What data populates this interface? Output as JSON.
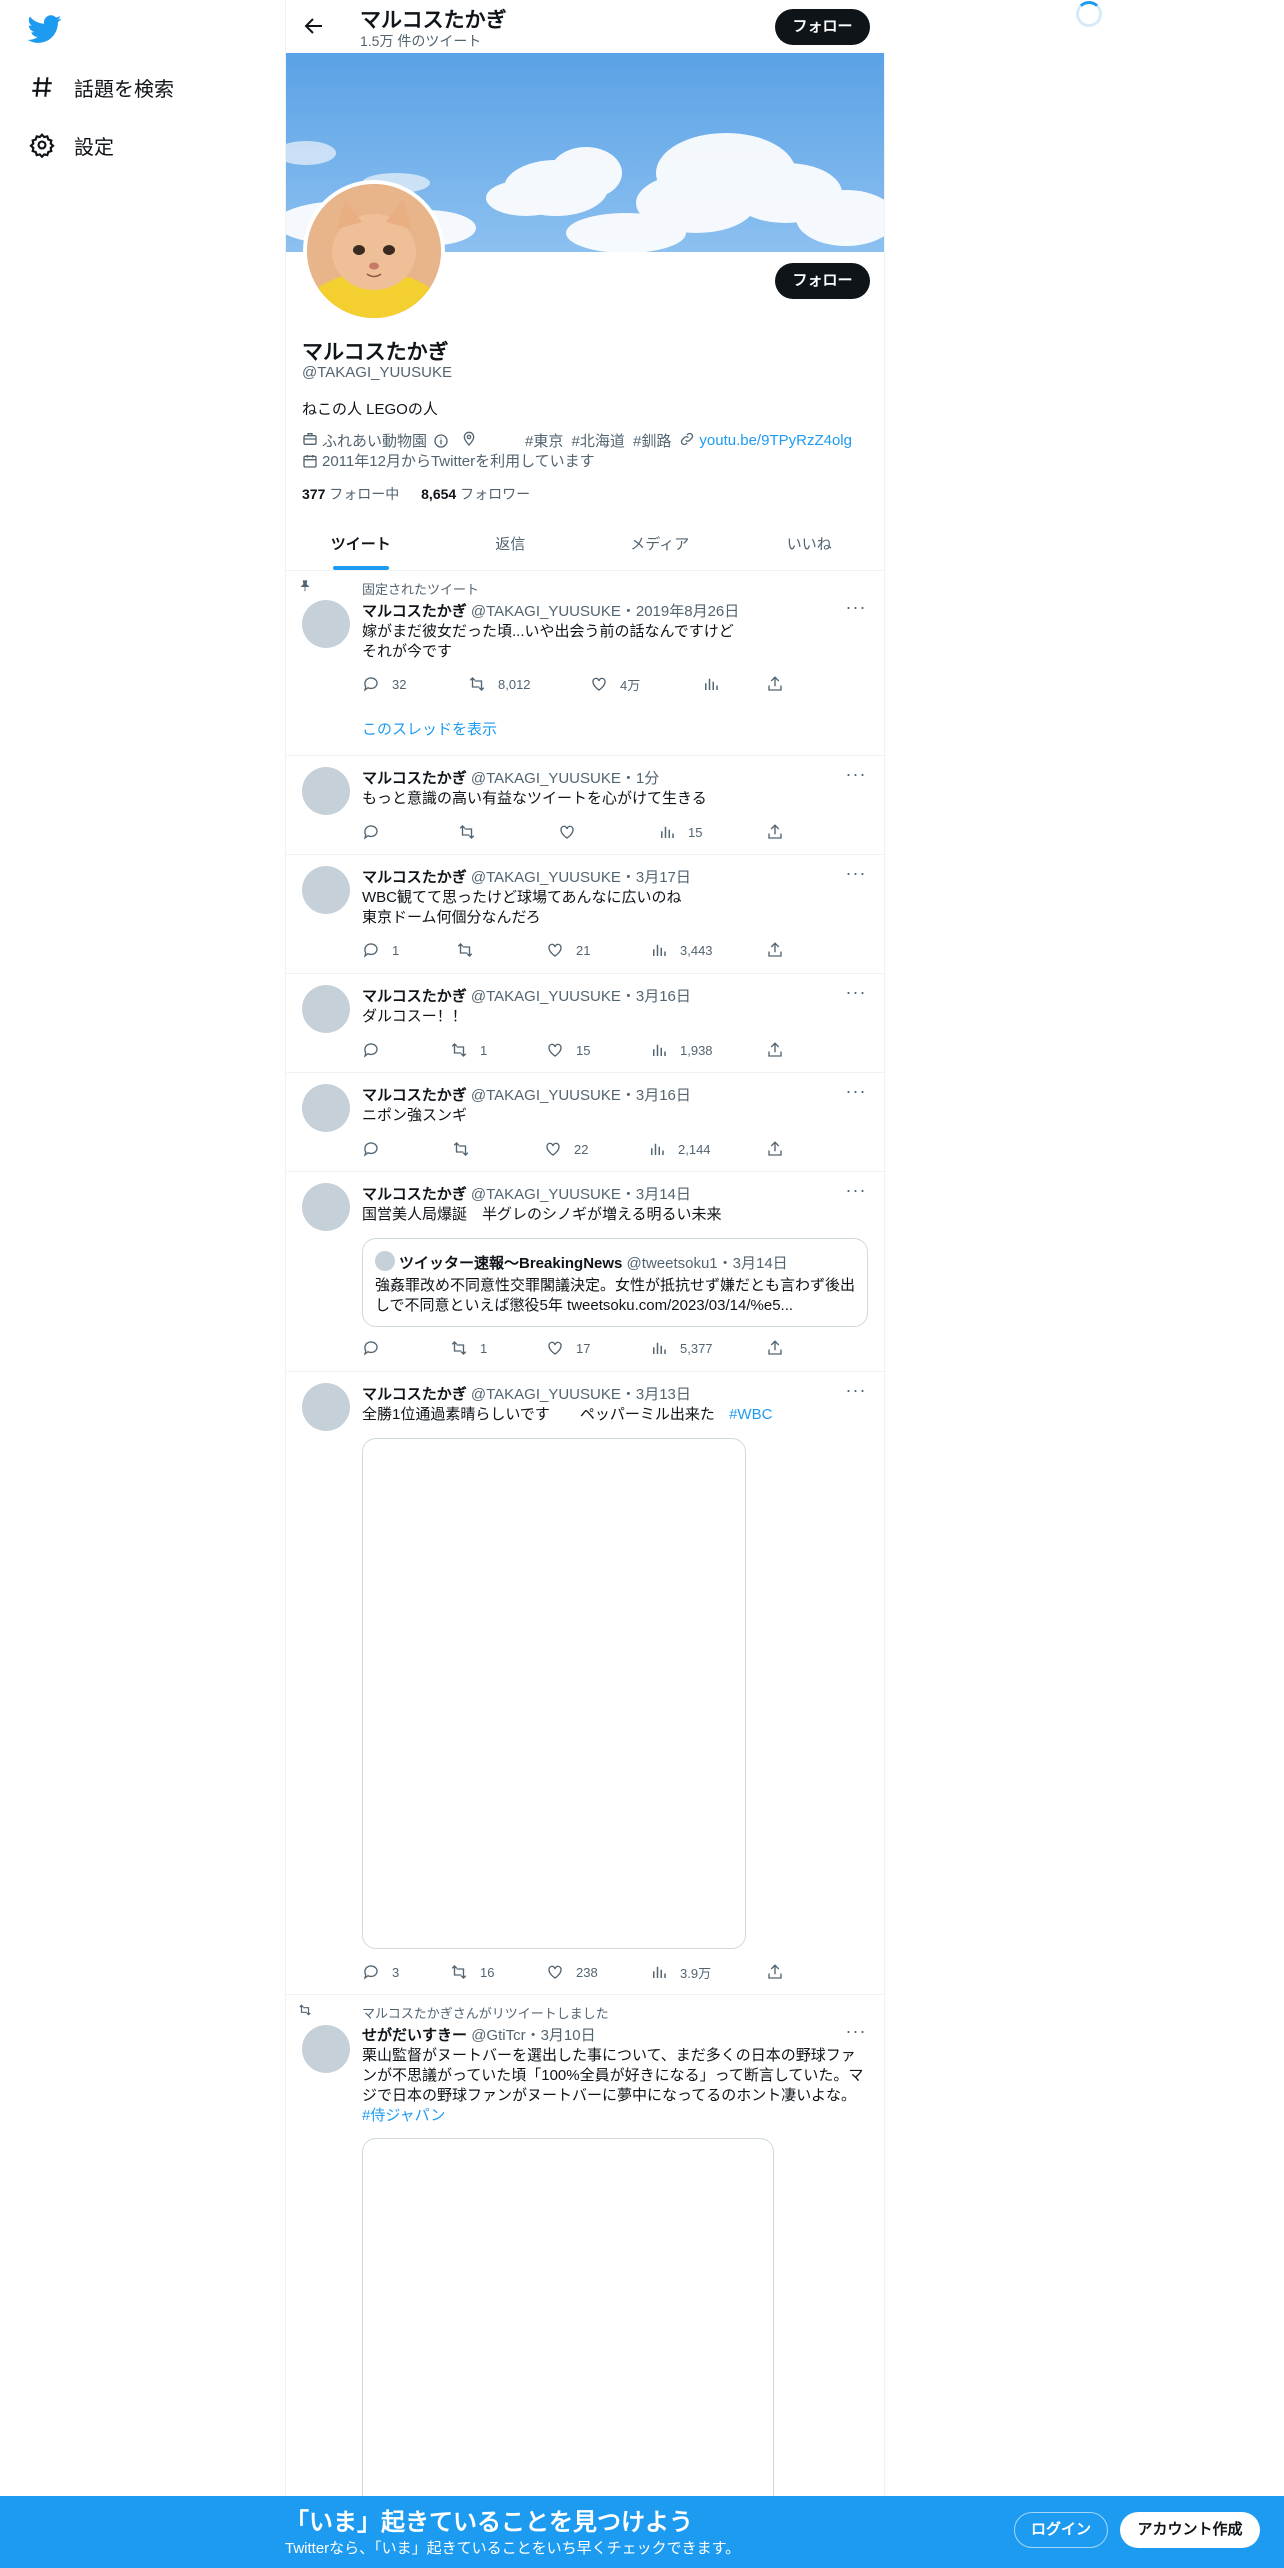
{
  "nav": {
    "explore_label": "話題を検索",
    "settings_label": "設定"
  },
  "header": {
    "name": "マルコスたかぎ",
    "tweet_count": "1.5万 件のツイート",
    "follow_label": "フォロー"
  },
  "profile": {
    "name": "マルコスたかぎ",
    "handle": "@TAKAGI_YUUSUKE",
    "bio": "ねこの人 LEGOの人",
    "category": "ふれあい動物園",
    "location": "#東京 #北海道 #釧路",
    "url": "youtu.be/9TPyRzZ4olg",
    "joined": "2011年12月からTwitterを利用しています",
    "following_count": "377",
    "following_label": "フォロー中",
    "followers_count": "8,654",
    "followers_label": "フォロワー",
    "follow_label": "フォロー"
  },
  "tabs": [
    "ツイート",
    "返信",
    "メディア",
    "いいね"
  ],
  "pinned_label": "固定されたツイート",
  "show_thread": "このスレッドを表示",
  "tweets": [
    {
      "name": "マルコスたかぎ",
      "meta": "@TAKAGI_YUUSUKE・2019年8月26日",
      "text1": "嫁がまだ彼女だった頃...いや出会う前の話なんですけど",
      "text2": "それが今です",
      "replies": "32",
      "retweets": "8,012",
      "likes": "4万",
      "views": ""
    },
    {
      "name": "マルコスたかぎ",
      "meta": "@TAKAGI_YUUSUKE・1分",
      "text1": "もっと意識の高い有益なツイートを心がけて生きる",
      "replies": "",
      "retweets": "",
      "likes": "",
      "views": "15"
    },
    {
      "name": "マルコスたかぎ",
      "meta": "@TAKAGI_YUUSUKE・3月17日",
      "text1": "WBC観てて思ったけど球場てあんなに広いのね",
      "text2": "東京ドーム何個分なんだろ",
      "replies": "1",
      "retweets": "",
      "likes": "21",
      "views": "3,443"
    },
    {
      "name": "マルコスたかぎ",
      "meta": "@TAKAGI_YUUSUKE・3月16日",
      "text1": "ダルコスー！！",
      "replies": "",
      "retweets": "1",
      "likes": "15",
      "views": "1,938"
    },
    {
      "name": "マルコスたかぎ",
      "meta": "@TAKAGI_YUUSUKE・3月16日",
      "text1": "ニポン強スンギ",
      "replies": "",
      "retweets": "",
      "likes": "22",
      "views": "2,144"
    },
    {
      "name": "マルコスたかぎ",
      "meta": "@TAKAGI_YUUSUKE・3月14日",
      "text1": "国営美人局爆誕　半グレのシノギが増える明るい未来",
      "replies": "",
      "retweets": "1",
      "likes": "17",
      "views": "5,377",
      "quote": {
        "name": "ツイッター速報〜BreakingNews",
        "meta": "@tweetsoku1・3月14日",
        "text1": "強姦罪改め不同意性交罪閣議決定。女性が抵抗せず嫌だとも言わず後出",
        "text2": "しで不同意といえば懲役5年 tweetsoku.com/2023/03/14/%e5..."
      }
    },
    {
      "name": "マルコスたかぎ",
      "meta": "@TAKAGI_YUUSUKE・3月13日",
      "text1": "全勝1位通過素晴らしいです　　ペッパーミル出来た",
      "hashtag": "#WBC",
      "replies": "3",
      "retweets": "16",
      "likes": "238",
      "views": "3.9万"
    },
    {
      "retweeted_by": "マルコスたかぎさんがリツイートしました",
      "name": "せがだいすきー",
      "meta": "@GtiTcr・3月10日",
      "text1": "栗山監督がヌートバーを選出した事について、まだ多くの日本の野球ファ",
      "text2": "ンが不思議がっていた頃「100%全員が好きになる」って断言していた。マ",
      "text3": "ジで日本の野球ファンがヌートバーに夢中になってるのホント凄いよな。",
      "hashtag": "#侍ジャパン"
    }
  ],
  "bottom": {
    "title": "「いま」起きていることを見つけよう",
    "subtitle": "Twitterなら、「いま」起きていることをいち早くチェックできます。",
    "login": "ログイン",
    "signup": "アカウント作成"
  },
  "colors": {
    "accent": "#1d9bf0",
    "text": "#0f1419",
    "muted": "#536471"
  }
}
